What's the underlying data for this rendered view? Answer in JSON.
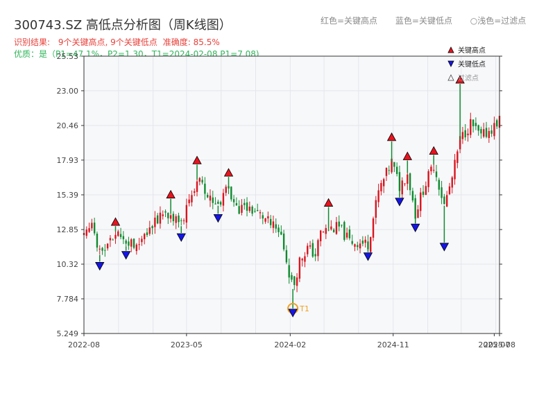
{
  "header": {
    "title": "300743.SZ 高低点分析图（周K线图）",
    "legend_hints": [
      "红色=关键高点",
      "蓝色=关键低点",
      "○浅色=过滤点"
    ],
    "result_prefix": "识别结果: ",
    "result_detail": "9个关键高点, 9个关键低点",
    "accuracy": "准确度: 85.5%",
    "quality_line": "优质：是（P1=47.1%，P2=1.30，T1=2024-02-08 P1=7.08)"
  },
  "chart_data": {
    "type": "candlestick",
    "title": "300743.SZ 高低点分析图（周K线图）",
    "ylim": [
      5.249,
      25.53
    ],
    "yticks": [
      "25.53",
      "23.00",
      "20.46",
      "17.93",
      "15.39",
      "12.85",
      "10.32",
      "7.784",
      "5.249"
    ],
    "xticks": [
      "2022-08",
      "2023-05",
      "2024-02",
      "2024-11",
      "2025-07",
      "2025-08"
    ],
    "xrange": [
      "2022-08-01",
      "2025-08-11"
    ],
    "grid": true,
    "legend": {
      "position": "top-right",
      "entries": [
        {
          "label": "关键高点",
          "marker": "up-triangle",
          "color": "#e8141e"
        },
        {
          "label": "关键低点",
          "marker": "down-triangle",
          "color": "#1515e8"
        },
        {
          "label": "过滤点",
          "marker": "up-triangle-outline",
          "color": "#aaaaaa"
        }
      ]
    },
    "colors": {
      "up": "#d9141e",
      "down": "#0f8a2f",
      "high": "#e8141e",
      "low": "#1515e8",
      "t1": "#f0a020"
    },
    "key_highs": [
      {
        "date": "2022-10-24",
        "price": 13.1
      },
      {
        "date": "2023-03-20",
        "price": 15.1
      },
      {
        "date": "2023-05-29",
        "price": 17.6
      },
      {
        "date": "2023-08-21",
        "price": 16.7
      },
      {
        "date": "2024-05-13",
        "price": 14.5
      },
      {
        "date": "2024-10-28",
        "price": 19.3
      },
      {
        "date": "2024-12-09",
        "price": 17.9
      },
      {
        "date": "2025-02-17",
        "price": 18.3
      },
      {
        "date": "2025-04-28",
        "price": 23.5
      }
    ],
    "key_lows": [
      {
        "date": "2022-09-12",
        "price": 10.5
      },
      {
        "date": "2022-11-21",
        "price": 11.3
      },
      {
        "date": "2023-04-17",
        "price": 12.6
      },
      {
        "date": "2023-07-24",
        "price": 14.0
      },
      {
        "date": "2024-02-08",
        "price": 7.08
      },
      {
        "date": "2024-08-26",
        "price": 11.2
      },
      {
        "date": "2024-11-18",
        "price": 15.2
      },
      {
        "date": "2024-12-30",
        "price": 13.3
      },
      {
        "date": "2025-03-17",
        "price": 11.9
      }
    ],
    "t1": {
      "label": "T1",
      "date": "2024-02-08",
      "price": 7.08
    },
    "price_path": [
      [
        "2022-08-01",
        12.3
      ],
      [
        "2022-08-22",
        12.9
      ],
      [
        "2022-09-12",
        11.0
      ],
      [
        "2022-10-03",
        11.8
      ],
      [
        "2022-10-24",
        12.7
      ],
      [
        "2022-11-21",
        11.6
      ],
      [
        "2023-01-02",
        12.2
      ],
      [
        "2023-02-13",
        13.6
      ],
      [
        "2023-03-20",
        14.0
      ],
      [
        "2023-04-17",
        13.1
      ],
      [
        "2023-05-29",
        16.5
      ],
      [
        "2023-07-03",
        15.0
      ],
      [
        "2023-07-24",
        14.6
      ],
      [
        "2023-08-21",
        15.9
      ],
      [
        "2023-09-11",
        14.4
      ],
      [
        "2023-10-16",
        14.4
      ],
      [
        "2023-11-20",
        13.8
      ],
      [
        "2024-01-08",
        12.4
      ],
      [
        "2024-02-08",
        8.5
      ],
      [
        "2024-02-26",
        10.6
      ],
      [
        "2024-03-18",
        11.5
      ],
      [
        "2024-04-08",
        11.0
      ],
      [
        "2024-04-22",
        12.6
      ],
      [
        "2024-05-13",
        12.9
      ],
      [
        "2024-06-10",
        13.0
      ],
      [
        "2024-07-08",
        12.0
      ],
      [
        "2024-08-26",
        11.8
      ],
      [
        "2024-09-23",
        15.6
      ],
      [
        "2024-10-28",
        17.8
      ],
      [
        "2024-11-18",
        16.0
      ],
      [
        "2024-12-09",
        17.0
      ],
      [
        "2024-12-30",
        14.0
      ],
      [
        "2025-01-20",
        15.8
      ],
      [
        "2025-02-17",
        17.6
      ],
      [
        "2025-03-17",
        14.6
      ],
      [
        "2025-04-07",
        16.6
      ],
      [
        "2025-04-28",
        19.4
      ],
      [
        "2025-05-26",
        20.6
      ],
      [
        "2025-06-23",
        19.6
      ],
      [
        "2025-07-28",
        20.4
      ],
      [
        "2025-08-11",
        20.9
      ]
    ]
  }
}
